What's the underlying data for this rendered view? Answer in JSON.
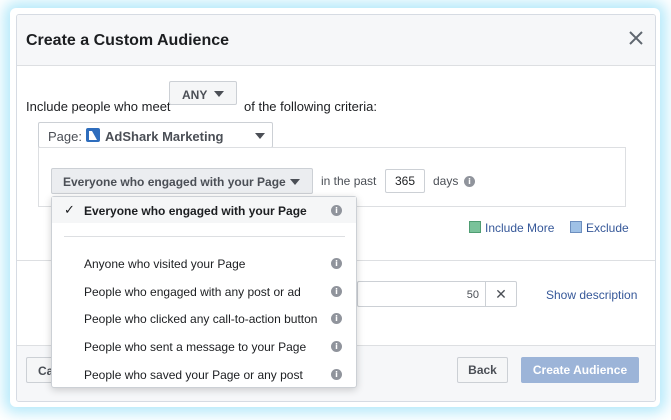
{
  "dialog": {
    "title": "Create a Custom Audience"
  },
  "criteria": {
    "prefix": "Include people who meet",
    "match_value": "ANY",
    "suffix": "of the following criteria:"
  },
  "page_selector": {
    "label": "Page:",
    "page_name": "AdShark Marketing"
  },
  "rule": {
    "engagement_selected": "Everyone who engaged with your Page",
    "in_the_past_label": "in the past",
    "days_value": "365",
    "days_label": "days"
  },
  "actions": {
    "include_more": "Include More",
    "exclude": "Exclude"
  },
  "description": {
    "char_count": "50",
    "clear_icon": "✕",
    "show_description": "Show description"
  },
  "footer": {
    "cancel_label": "Ca",
    "back_label": "Back",
    "create_label": "Create Audience"
  },
  "dropdown": {
    "selected_check": "✓",
    "items": [
      {
        "label": "Everyone who engaged with your Page"
      },
      {
        "label": "Anyone who visited your Page"
      },
      {
        "label": "People who engaged with any post or ad"
      },
      {
        "label": "People who clicked any call-to-action button"
      },
      {
        "label": "People who sent a message to your Page"
      },
      {
        "label": "People who saved your Page or any post"
      }
    ]
  },
  "colors": {
    "link": "#365899",
    "primary_disabled": "#9cb4d8",
    "glow": "#78d7f5"
  }
}
